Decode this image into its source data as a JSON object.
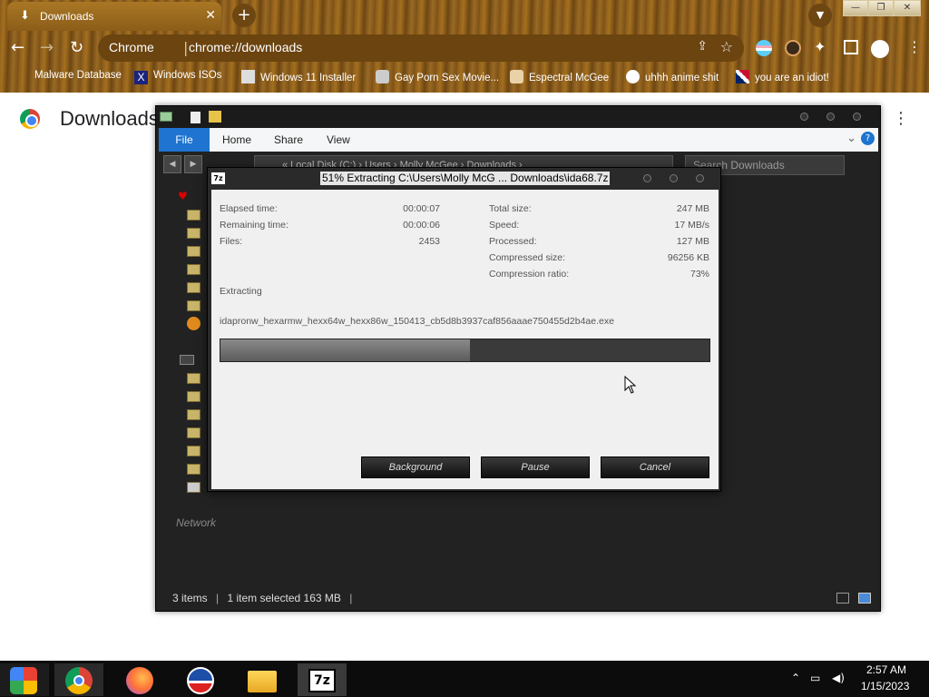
{
  "browser": {
    "tab_title": "Downloads",
    "tab_icon": "download-icon",
    "site_label": "Chrome",
    "url": "chrome://downloads",
    "bookmarks": [
      {
        "label": "Malware Database",
        "icon": "bookmark-icon"
      },
      {
        "label": "Windows ISOs",
        "icon": "x-logo-icon"
      },
      {
        "label": "Windows 11 Installer",
        "icon": "image-icon"
      },
      {
        "label": "Gay Porn Sex Movie...",
        "icon": "site-icon"
      },
      {
        "label": "Espectral McGee",
        "icon": "site-icon"
      },
      {
        "label": "uhhh anime shit",
        "icon": "site-icon"
      },
      {
        "label": "you are an idiot!",
        "icon": "flag-icon"
      }
    ],
    "page_title": "Downloads"
  },
  "explorer": {
    "ribbon_tabs": [
      "File",
      "Home",
      "Share",
      "View"
    ],
    "address": "« Local Disk (C:) › Users › Molly McGee › Downloads ›",
    "search_placeholder": "Search Downloads",
    "network_label": "Network",
    "status_items": "3 items",
    "status_selected": "1 item selected  163 MB"
  },
  "dialog": {
    "title": "51% Extracting C:\\Users\\Molly McG ... Downloads\\ida68.7z",
    "icon_label": "7z",
    "stats_left": [
      {
        "label": "Elapsed time:",
        "value": "00:00:07"
      },
      {
        "label": "Remaining time:",
        "value": "00:00:06"
      },
      {
        "label": "Files:",
        "value": "2453"
      }
    ],
    "stats_right": [
      {
        "label": "Total size:",
        "value": "247 MB"
      },
      {
        "label": "Speed:",
        "value": "17 MB/s"
      },
      {
        "label": "Processed:",
        "value": "127 MB"
      },
      {
        "label": "Compressed size:",
        "value": "96256 KB"
      },
      {
        "label": "Compression ratio:",
        "value": "73%"
      }
    ],
    "status": "Extracting",
    "current_file": "idapronw_hexarmw_hexx64w_hexx86w_150413_cb5d8b3937caf856aaae750455d2b4ae.exe",
    "progress_fraction": 0.51,
    "buttons": {
      "background": "Background",
      "pause": "Pause",
      "cancel": "Cancel"
    }
  },
  "taskbar": {
    "apps": [
      "start-icon",
      "chrome-icon",
      "firefox-icon",
      "obama-logo-icon",
      "file-explorer-icon",
      "7zip-icon"
    ],
    "time": "2:57 AM",
    "date": "1/15/2023"
  }
}
